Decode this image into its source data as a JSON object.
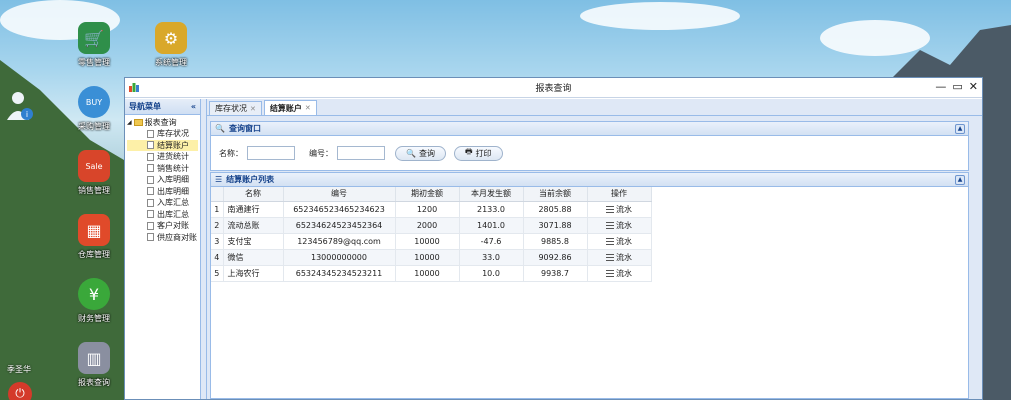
{
  "desktop": {
    "icons": [
      {
        "label": "零售管理",
        "glyph": "🛒"
      },
      {
        "label": "系统管理",
        "glyph": "⚙"
      },
      {
        "label": "采购管理",
        "glyph": "BUY"
      },
      {
        "label": "销售管理",
        "glyph": "Sale"
      },
      {
        "label": "仓库管理",
        "glyph": "▦"
      },
      {
        "label": "财务管理",
        "glyph": "¥"
      },
      {
        "label": "报表查询",
        "glyph": "▥"
      }
    ],
    "user_name": "季圣华"
  },
  "window": {
    "title": "报表查询",
    "minimize": "—",
    "maximize": "▭",
    "close": "✕"
  },
  "nav": {
    "title": "导航菜单",
    "collapse": "«",
    "root": "报表查询",
    "items": [
      {
        "label": "库存状况",
        "selected": false
      },
      {
        "label": "结算账户",
        "selected": true
      },
      {
        "label": "进货统计",
        "selected": false
      },
      {
        "label": "销售统计",
        "selected": false
      },
      {
        "label": "入库明细",
        "selected": false
      },
      {
        "label": "出库明细",
        "selected": false
      },
      {
        "label": "入库汇总",
        "selected": false
      },
      {
        "label": "出库汇总",
        "selected": false
      },
      {
        "label": "客户对账",
        "selected": false
      },
      {
        "label": "供应商对账",
        "selected": false
      }
    ]
  },
  "tabs": [
    {
      "label": "库存状况",
      "active": false
    },
    {
      "label": "结算账户",
      "active": true
    }
  ],
  "query": {
    "title": "查询窗口",
    "name_label": "名称：",
    "name_value": "",
    "code_label": "编号：",
    "code_value": "",
    "search_btn": "查询",
    "print_btn": "打印"
  },
  "list": {
    "title": "结算账户列表",
    "headers": [
      "名称",
      "编号",
      "期初金额",
      "本月发生额",
      "当前余额",
      "操作"
    ],
    "rows": [
      {
        "no": "1",
        "name": "南通建行",
        "code": "652346523465234623",
        "initial": "1200",
        "month": "2133.0",
        "balance": "2805.88",
        "op": "流水"
      },
      {
        "no": "2",
        "name": "流动总账",
        "code": "65234624523452364",
        "initial": "2000",
        "month": "1401.0",
        "balance": "3071.88",
        "op": "流水"
      },
      {
        "no": "3",
        "name": "支付宝",
        "code": "123456789@qq.com",
        "initial": "10000",
        "month": "-47.6",
        "balance": "9885.8",
        "op": "流水"
      },
      {
        "no": "4",
        "name": "微信",
        "code": "13000000000",
        "initial": "10000",
        "month": "33.0",
        "balance": "9092.86",
        "op": "流水"
      },
      {
        "no": "5",
        "name": "上海农行",
        "code": "65324345234523211",
        "initial": "10000",
        "month": "10.0",
        "balance": "9938.7",
        "op": "流水"
      }
    ]
  }
}
